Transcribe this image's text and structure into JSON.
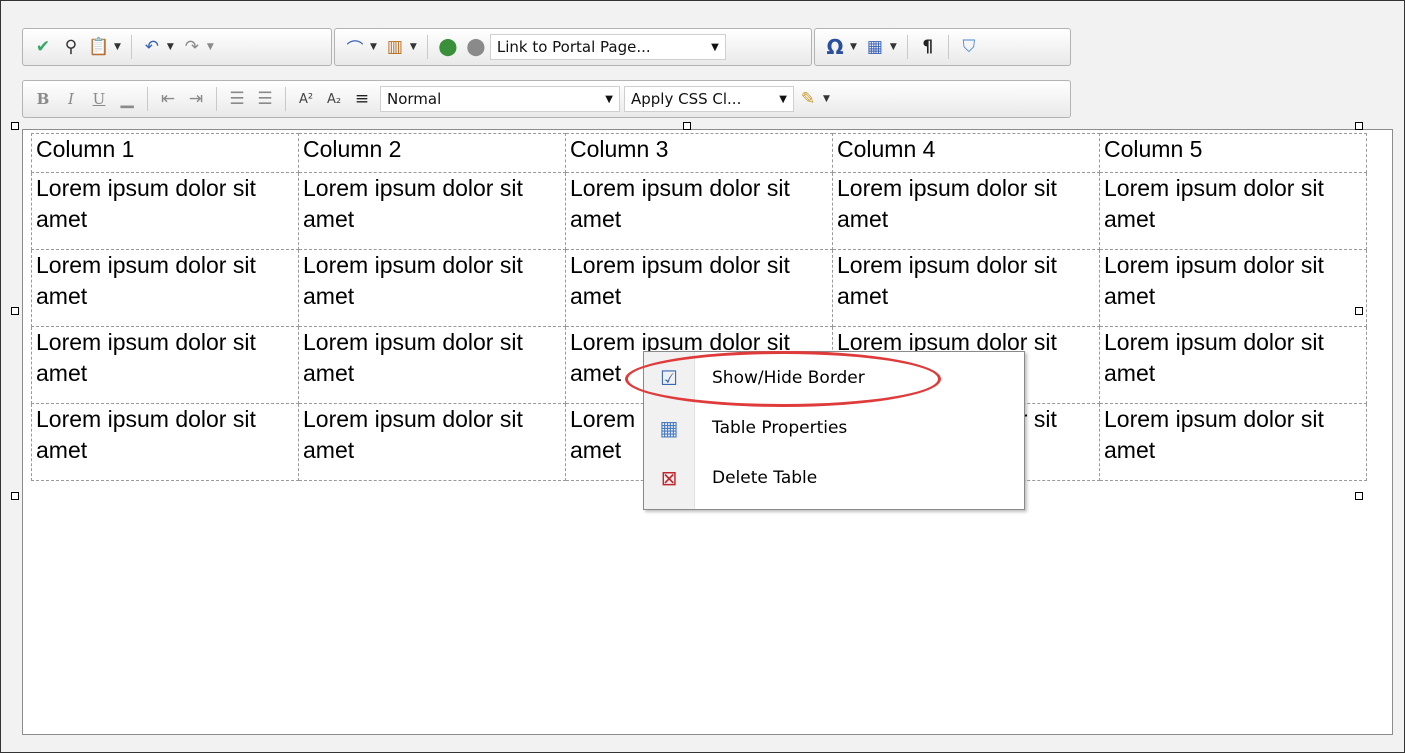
{
  "toolbar1": {
    "link_combo": "Link to Portal Page...",
    "icons": [
      "spellcheck-icon",
      "find-icon",
      "paste-icon",
      "undo-icon",
      "redo-icon",
      "hyperlink-icon",
      "image-manager-icon",
      "insert-link-icon",
      "remove-link-icon",
      "symbol-icon",
      "table-icon",
      "paragraph-icon",
      "clear-icon"
    ],
    "symbol_glyph": "Ω",
    "paragraph_glyph": "¶"
  },
  "toolbar2": {
    "format_combo": "Normal",
    "css_combo": "Apply CSS Cl...",
    "bold": "B",
    "italic": "I",
    "underline": "U"
  },
  "table": {
    "headers": [
      "Column 1",
      "Column 2",
      "Column 3",
      "Column 4",
      "Column 5"
    ],
    "rows": [
      [
        "Lorem ipsum dolor sit amet",
        "Lorem ipsum dolor sit amet",
        "Lorem ipsum dolor sit amet",
        "Lorem ipsum dolor sit amet",
        "Lorem ipsum dolor sit amet"
      ],
      [
        "Lorem ipsum dolor sit amet",
        "Lorem ipsum dolor sit amet",
        "Lorem ipsum dolor sit amet",
        "Lorem ipsum dolor sit amet",
        "Lorem ipsum dolor sit amet"
      ],
      [
        "Lorem ipsum dolor sit amet",
        "Lorem ipsum dolor sit amet",
        "Lorem ipsum dolor sit amet",
        "Lorem ipsum dolor sit amet",
        "Lorem ipsum dolor sit amet"
      ],
      [
        "Lorem ipsum dolor sit amet",
        "Lorem ipsum dolor sit amet",
        "Lorem ipsum dolor sit amet",
        "Lorem ipsum dolor sit amet",
        "Lorem ipsum dolor sit amet"
      ]
    ]
  },
  "context_menu": {
    "items": [
      {
        "label": "Show/Hide Border",
        "icon": "show-hide-border-icon"
      },
      {
        "label": "Table Properties",
        "icon": "table-properties-icon"
      },
      {
        "label": "Delete Table",
        "icon": "delete-table-icon"
      }
    ],
    "highlight_color": "#e03b3b"
  }
}
